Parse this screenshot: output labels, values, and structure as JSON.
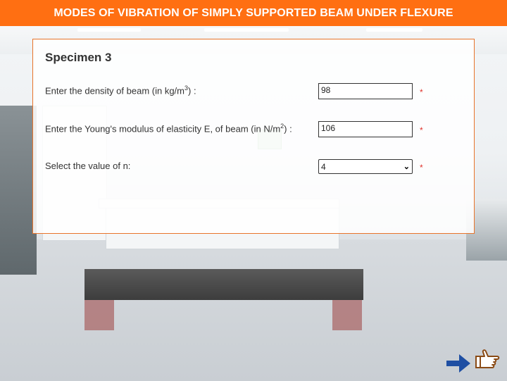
{
  "header": {
    "title": "MODES OF VIBRATION OF SIMPLY SUPPORTED BEAM UNDER FLEXURE"
  },
  "form": {
    "title": "Specimen 3",
    "density": {
      "label": "Enter the density of beam (in kg/m",
      "sup": "3",
      "suffix": ") :",
      "value": "98",
      "required": "*"
    },
    "youngs": {
      "label": "Enter the Young's modulus of elasticity E, of beam (in N/m",
      "sup": "2",
      "suffix": ") :",
      "value": "106",
      "required": "*"
    },
    "n_select": {
      "label": "Select the value of n:",
      "value": "4",
      "required": "*"
    }
  },
  "icons": {
    "next": "arrow-right-icon",
    "pointer": "hand-pointer-icon"
  },
  "colors": {
    "header": "#ff6f12",
    "arrow": "#1f4fa3",
    "hand": "#8a4b16",
    "required": "#e0322b"
  }
}
